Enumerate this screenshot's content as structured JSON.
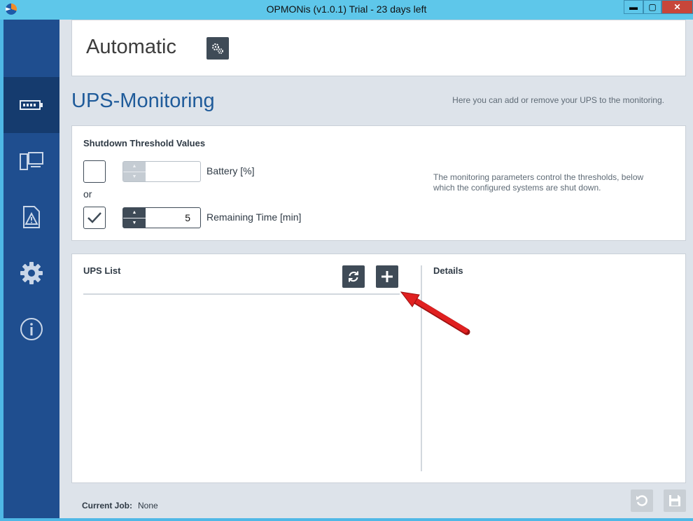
{
  "window": {
    "title": "OPMONis (v1.0.1) Trial - 23 days left",
    "min_label": "▬",
    "max_label": "▢",
    "close_label": "✕"
  },
  "sidebar": {
    "items": [
      {
        "icon": "battery-icon",
        "active": true
      },
      {
        "icon": "devices-icon",
        "active": false
      },
      {
        "icon": "warning-document-icon",
        "active": false
      },
      {
        "icon": "gear-icon",
        "active": false
      },
      {
        "icon": "info-icon",
        "active": false
      }
    ]
  },
  "mode": {
    "title": "Automatic",
    "settings_icon": "gears-icon"
  },
  "section": {
    "title": "UPS-Monitoring",
    "description": "Here you can add or remove your UPS to the monitoring."
  },
  "threshold": {
    "title": "Shutdown Threshold Values",
    "battery": {
      "checked": false,
      "value": "",
      "label": "Battery [%]"
    },
    "or_label": "or",
    "time": {
      "checked": true,
      "value": "5",
      "label": "Remaining Time [min]"
    },
    "help_text_line1": "The monitoring parameters control the thresholds, below",
    "help_text_line2": "which the configured systems are shut down."
  },
  "ups_list": {
    "title": "UPS List",
    "refresh_icon": "refresh-icon",
    "add_icon": "plus-icon",
    "items": []
  },
  "details": {
    "title": "Details"
  },
  "footer": {
    "job_label": "Current Job:",
    "job_value": "None",
    "undo_icon": "undo-icon",
    "save_icon": "save-icon"
  },
  "colors": {
    "sidebar": "#1f4e8f",
    "sidebar_active": "#153b6e",
    "accent": "#1f5b9a",
    "button_dark": "#3f4b57",
    "annotation_arrow": "#e02020"
  }
}
